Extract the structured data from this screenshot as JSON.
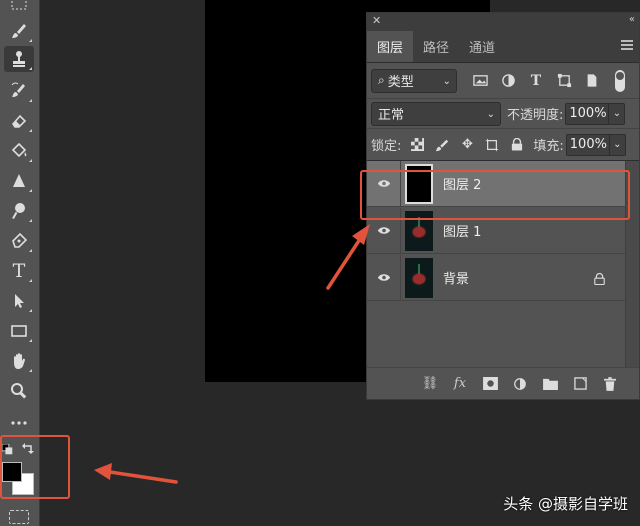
{
  "app": {
    "accent_color": "#e2533b"
  },
  "toolbar": {
    "tools": [
      {
        "name": "marquee-tool-icon"
      },
      {
        "name": "brush-tool-icon"
      },
      {
        "name": "clone-stamp-tool-icon",
        "active": true
      },
      {
        "name": "history-brush-tool-icon"
      },
      {
        "name": "eraser-tool-icon"
      },
      {
        "name": "paint-bucket-tool-icon"
      },
      {
        "name": "sharpen-tool-icon"
      },
      {
        "name": "dodge-tool-icon"
      },
      {
        "name": "pen-tool-icon"
      },
      {
        "name": "type-tool-icon"
      },
      {
        "name": "path-selection-tool-icon"
      },
      {
        "name": "rectangle-tool-icon"
      },
      {
        "name": "hand-tool-icon"
      },
      {
        "name": "zoom-tool-icon"
      },
      {
        "name": "more-tools-icon"
      }
    ],
    "type_tool_label": "T",
    "foreground_color": "#000000",
    "background_color": "#ffffff"
  },
  "layers_panel": {
    "tabs": [
      {
        "label": "图层",
        "active": true
      },
      {
        "label": "路径",
        "active": false
      },
      {
        "label": "通道",
        "active": false
      }
    ],
    "filter": {
      "label": "类型"
    },
    "blend_mode": "正常",
    "opacity_label": "不透明度:",
    "opacity_value": "100%",
    "lock_label": "锁定:",
    "fill_label": "填充:",
    "fill_value": "100%",
    "layers": [
      {
        "name": "图层 2",
        "selected": true,
        "visible": true,
        "thumbnail": "black"
      },
      {
        "name": "图层 1",
        "selected": false,
        "visible": true,
        "thumbnail": "rose"
      },
      {
        "name": "背景",
        "selected": false,
        "visible": true,
        "thumbnail": "rose",
        "locked": true
      }
    ],
    "fx_label": "fx"
  },
  "watermark": "头条 @摄影自学班"
}
